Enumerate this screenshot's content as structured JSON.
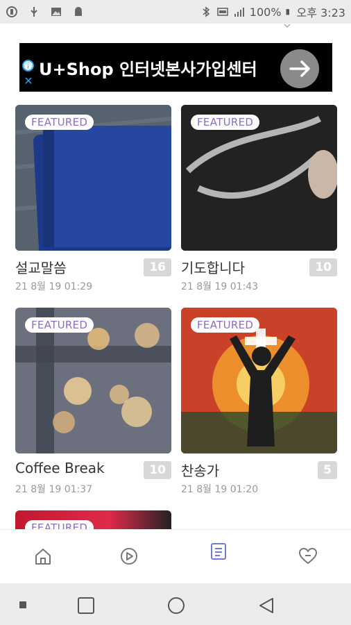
{
  "status_bar": {
    "left_icons": [
      "usb-icon",
      "usb-debug-icon",
      "image-icon",
      "android-icon"
    ],
    "right_icons": [
      "bluetooth-icon",
      "cast-icon",
      "signal-icon"
    ],
    "battery": "100%",
    "time": "오후 3:23"
  },
  "ad": {
    "title": "U+Shop 인터넷본사가입센터",
    "info_icon": "ⓘ",
    "close_icon": "✕"
  },
  "cards": [
    {
      "badge": "FEATURED",
      "title": "설교말씀",
      "count": "16",
      "date": "21 8월 19 01:29"
    },
    {
      "badge": "FEATURED",
      "title": "기도합니다",
      "count": "10",
      "date": "21 8월 19 01:43"
    },
    {
      "badge": "FEATURED",
      "title": "Coffee Break",
      "count": "10",
      "date": "21 8월 19 01:37"
    },
    {
      "badge": "FEATURED",
      "title": "찬송가",
      "count": "5",
      "date": "21 8월 19 01:20"
    },
    {
      "badge": "FEATURED"
    }
  ],
  "bottom_nav": [
    {
      "icon": "home-icon"
    },
    {
      "icon": "play-icon"
    },
    {
      "icon": "list-icon"
    },
    {
      "icon": "heart-icon"
    }
  ],
  "system_nav": [
    "recents-square-icon",
    "home-circle-icon",
    "back-triangle-icon"
  ],
  "colors": {
    "accent": "#6f7ad8",
    "badge_text": "#8a6cc9",
    "count_bg": "#d8d8d8"
  }
}
